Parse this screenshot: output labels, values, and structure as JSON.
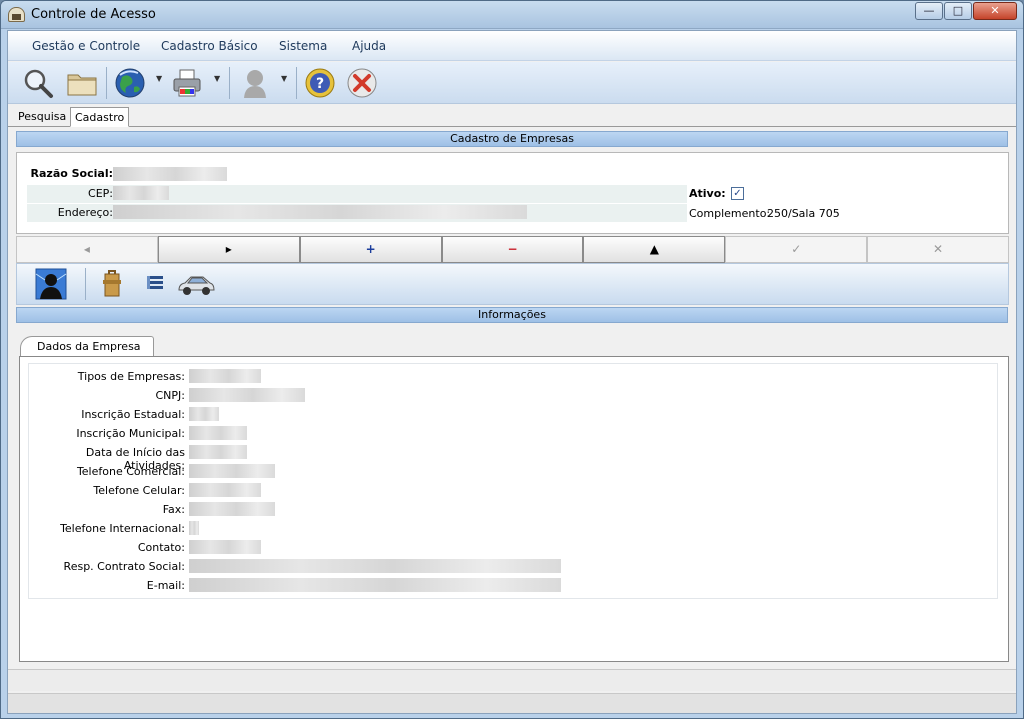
{
  "window": {
    "title": "Controle de Acesso",
    "minimize_glyph": "—",
    "maximize_glyph": "□",
    "close_glyph": "✕"
  },
  "menu": [
    "Gestão e Controle",
    "Cadastro Básico",
    "Sistema",
    "Ajuda"
  ],
  "toolbar": {
    "icons": [
      "search-icon",
      "folder-icon",
      "globe-icon",
      "printer-icon",
      "user-silhouette-icon",
      "help-icon",
      "close-circle-icon"
    ],
    "dropdown_glyph": "▼"
  },
  "tabs": [
    {
      "label": "Pesquisa",
      "active": false
    },
    {
      "label": "Cadastro",
      "active": true
    }
  ],
  "cadastro": {
    "header": "Cadastro de Empresas",
    "razao_social_label": "Razão Social:",
    "cep_label": "CEP:",
    "endereco_label": "Endereço:",
    "ativo_label": "Ativo:",
    "ativo_checked": true,
    "ativo_check_glyph": "✓",
    "complemento_label": "Complemento:",
    "complemento_value": "250/Sala 705"
  },
  "navigation": [
    {
      "glyph": "◂",
      "enabled": false
    },
    {
      "glyph": "▸",
      "enabled": true
    },
    {
      "glyph": "+",
      "enabled": true,
      "color": "#1b3d9c"
    },
    {
      "glyph": "−",
      "enabled": true,
      "color": "#c8202a"
    },
    {
      "glyph": "▲",
      "enabled": true
    },
    {
      "glyph": "✓",
      "enabled": false
    },
    {
      "glyph": "✕",
      "enabled": false
    }
  ],
  "toolbar2": {
    "icons": [
      "user-profile-icon",
      "briefcase-icon",
      "list-icon",
      "car-icon"
    ]
  },
  "informacoes": {
    "header": "Informações",
    "tab_label": "Dados da Empresa",
    "fields": [
      "Tipos de Empresas:",
      "CNPJ:",
      "Inscrição Estadual:",
      "Inscrição Municipal:",
      "Data de Início das Atividades:",
      "Telefone Comercial:",
      "Telefone Celular:",
      "Fax:",
      "Telefone Internacional:",
      "Contato:",
      "Resp. Contrato Social:",
      "E-mail:"
    ]
  },
  "colors": {
    "accent": "#9ec0e6",
    "checkbox_check": "#27488a"
  }
}
